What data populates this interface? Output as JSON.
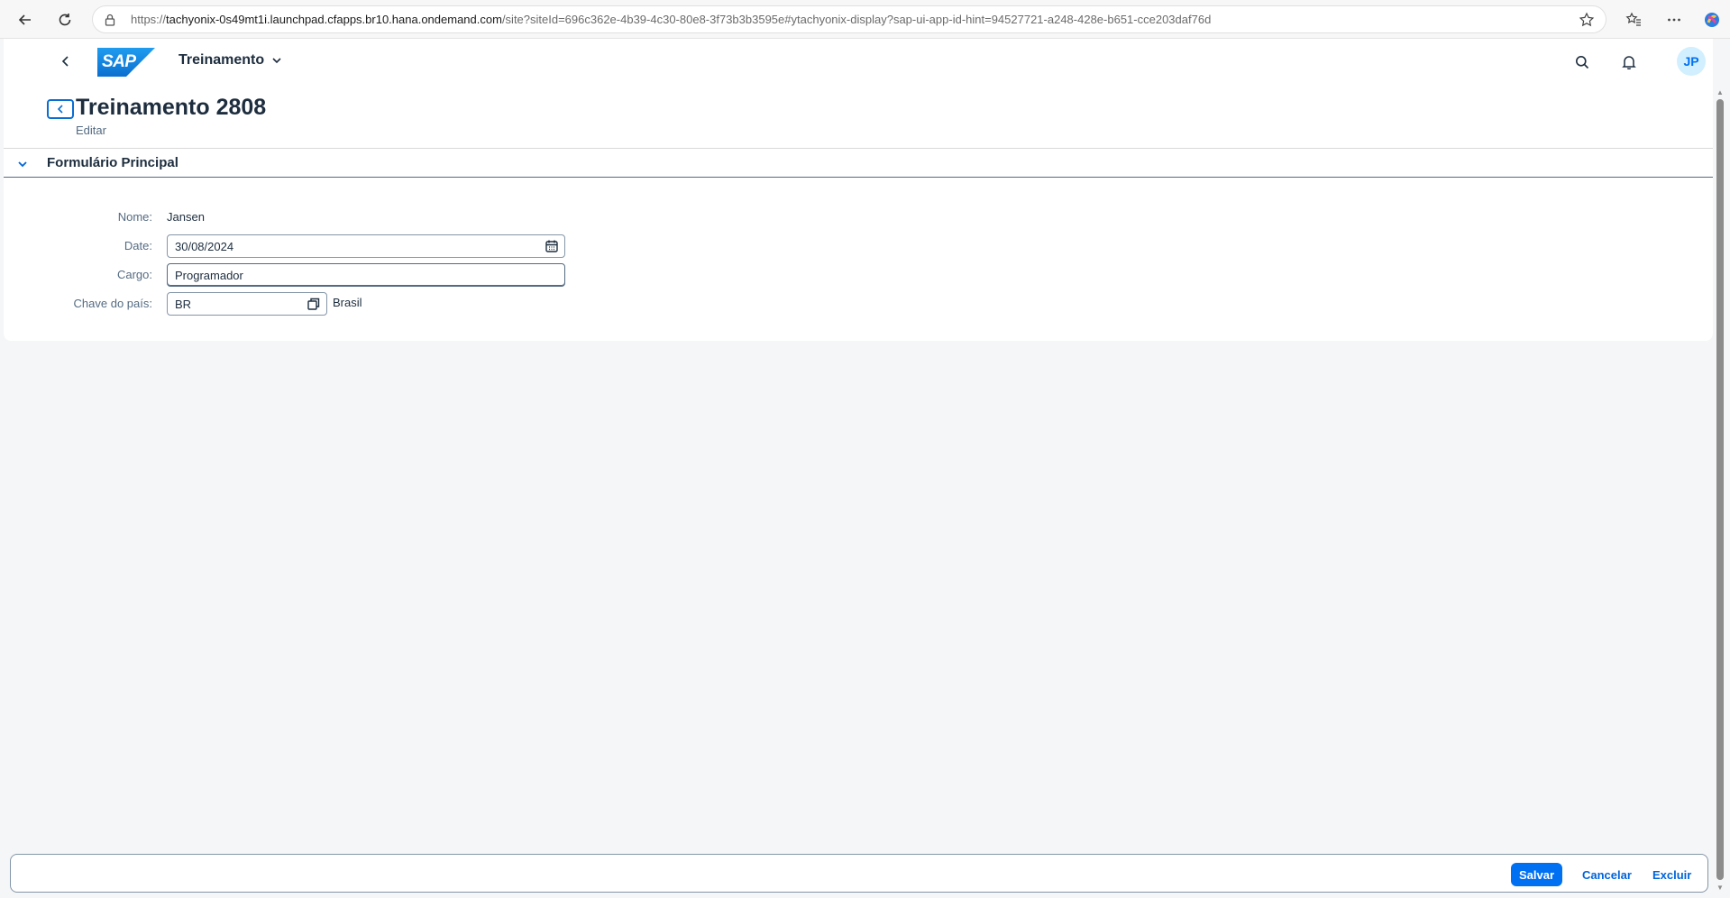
{
  "browser": {
    "url_prefix": "https://",
    "url_host": "tachyonix-0s49mt1i.launchpad.cfapps.br10.hana.ondemand.com",
    "url_rest": "/site?siteId=696c362e-4b39-4c30-80e8-3f73b3b3595e#ytachyonix-display?sap-ui-app-id-hint=94527721-a248-428e-b651-cce203daf76d"
  },
  "shell": {
    "logo_text": "SAP",
    "app_title": "Treinamento",
    "avatar_initials": "JP"
  },
  "page": {
    "title": "Treinamento 2808",
    "subtitle": "Editar"
  },
  "section": {
    "title": "Formulário Principal"
  },
  "form": {
    "nome_label": "Nome:",
    "nome_value": "Jansen",
    "date_label": "Date:",
    "date_value": "30/08/2024",
    "cargo_label": "Cargo:",
    "cargo_value": "Programador",
    "pais_label": "Chave do país:",
    "pais_value": "BR",
    "pais_desc": "Brasil"
  },
  "footer": {
    "save_label": "Salvar",
    "cancel_label": "Cancelar",
    "delete_label": "Excluir"
  },
  "colors": {
    "brand_blue": "#0070f2",
    "text_dark": "#1d2d3e",
    "label_grey": "#556b82",
    "page_bg": "#f5f6f7"
  }
}
